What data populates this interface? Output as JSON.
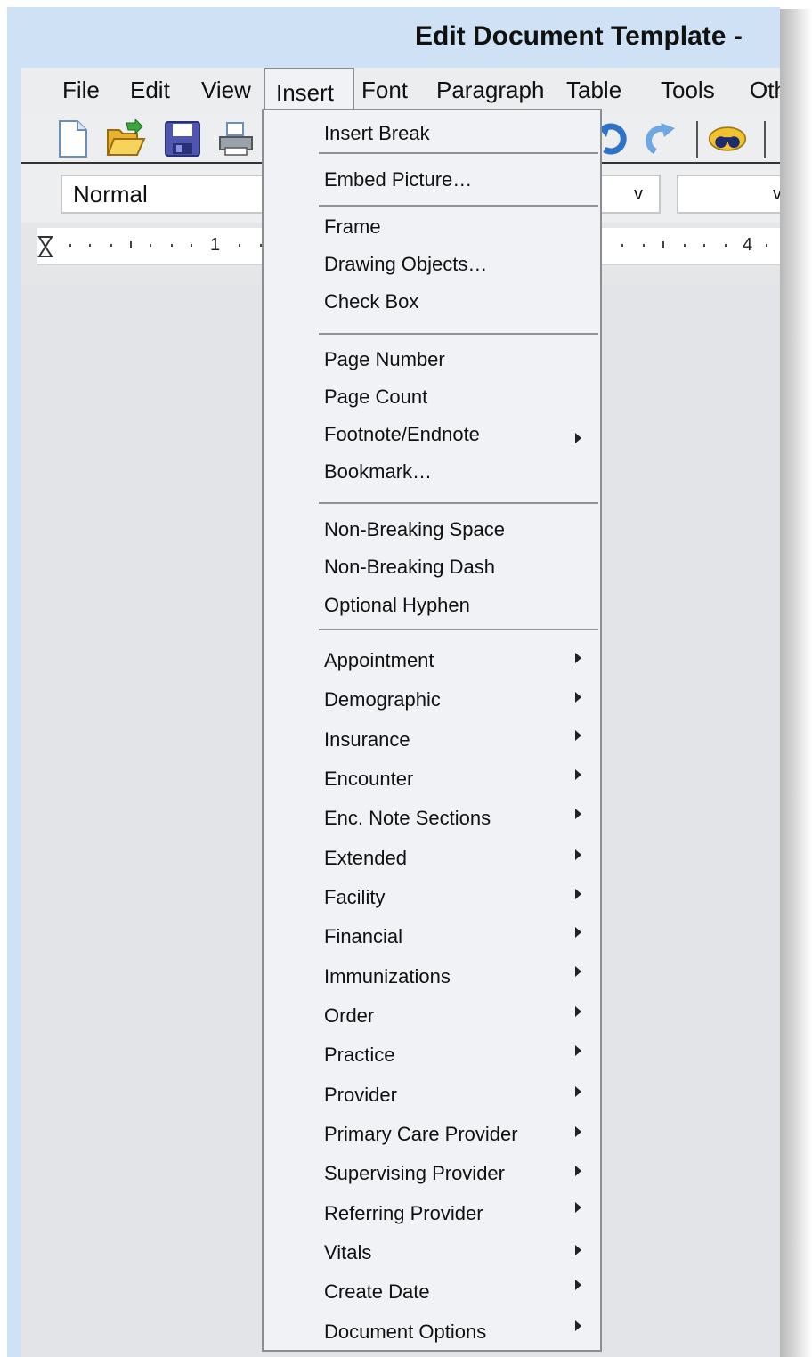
{
  "window": {
    "title": "Edit Document Template -"
  },
  "menubar": {
    "items": [
      "File",
      "Edit",
      "View",
      "Insert",
      "Font",
      "Paragraph",
      "Table",
      "Tools",
      "Other"
    ],
    "active": "Insert"
  },
  "toolbar": {
    "icons": [
      "new-document-icon",
      "open-folder-icon",
      "save-icon",
      "print-icon",
      "undo-icon",
      "redo-icon",
      "find-binoculars-icon"
    ]
  },
  "format": {
    "style_value": "Normal",
    "font_value": "v",
    "size_value": "v"
  },
  "ruler": {
    "numbers": [
      "1",
      "4"
    ]
  },
  "insert_menu": {
    "items": [
      {
        "label": "Insert Break"
      },
      {
        "label": "Embed Picture…"
      },
      {
        "label": "Frame"
      },
      {
        "label": "Drawing Objects…"
      },
      {
        "label": "Check Box"
      },
      {
        "label": "Page Number"
      },
      {
        "label": "Page Count"
      },
      {
        "label": "Footnote/Endnote",
        "submenu": true
      },
      {
        "label": "Bookmark…"
      },
      {
        "label": "Non-Breaking Space"
      },
      {
        "label": "Non-Breaking Dash"
      },
      {
        "label": "Optional Hyphen"
      },
      {
        "label": "Appointment",
        "submenu": true
      },
      {
        "label": "Demographic",
        "submenu": true
      },
      {
        "label": "Insurance",
        "submenu": true
      },
      {
        "label": "Encounter",
        "submenu": true
      },
      {
        "label": "Enc. Note Sections",
        "submenu": true
      },
      {
        "label": "Extended",
        "submenu": true
      },
      {
        "label": "Facility",
        "submenu": true
      },
      {
        "label": "Financial",
        "submenu": true
      },
      {
        "label": "Immunizations",
        "submenu": true
      },
      {
        "label": "Order",
        "submenu": true
      },
      {
        "label": "Practice",
        "submenu": true
      },
      {
        "label": "Provider",
        "submenu": true
      },
      {
        "label": "Primary Care Provider",
        "submenu": true
      },
      {
        "label": "Supervising Provider",
        "submenu": true
      },
      {
        "label": "Referring Provider",
        "submenu": true
      },
      {
        "label": "Vitals",
        "submenu": true
      },
      {
        "label": "Create Date",
        "submenu": true
      },
      {
        "label": "Document Options",
        "submenu": true
      }
    ]
  }
}
